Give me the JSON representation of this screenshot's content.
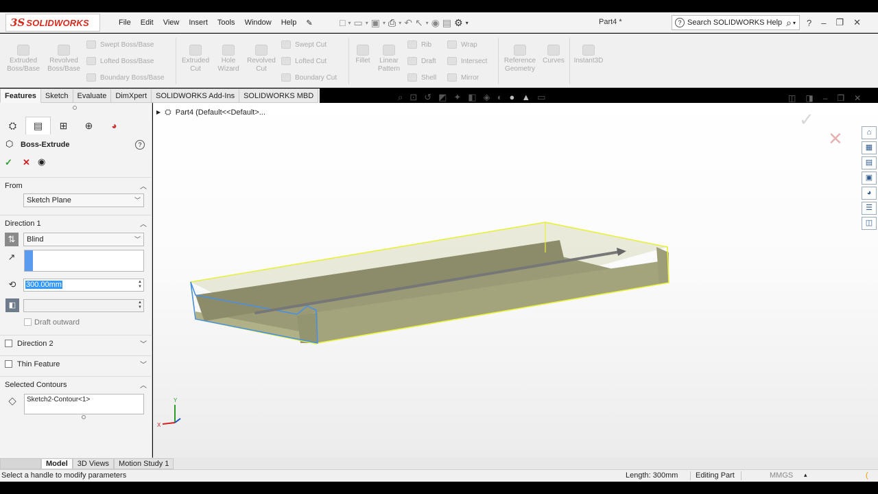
{
  "app": {
    "logo_ds": "3S",
    "logo_text": "SOLIDWORKS",
    "doc_title": "Part4 *"
  },
  "menu": [
    "File",
    "Edit",
    "View",
    "Insert",
    "Tools",
    "Window",
    "Help"
  ],
  "help_search": {
    "label": "Search SOLIDWORKS Help"
  },
  "toolbar": {
    "extruded_boss": "Extruded Boss/Base",
    "revolved_boss": "Revolved Boss/Base",
    "swept_boss": "Swept Boss/Base",
    "lofted_boss": "Lofted Boss/Base",
    "boundary_boss": "Boundary Boss/Base",
    "extruded_cut": "Extruded Cut",
    "hole_wizard": "Hole Wizard",
    "revolved_cut": "Revolved Cut",
    "swept_cut": "Swept Cut",
    "lofted_cut": "Lofted Cut",
    "boundary_cut": "Boundary Cut",
    "fillet": "Fillet",
    "linear_pattern": "Linear Pattern",
    "rib": "Rib",
    "draft": "Draft",
    "shell": "Shell",
    "wrap": "Wrap",
    "intersect": "Intersect",
    "mirror": "Mirror",
    "reference_geometry": "Reference Geometry",
    "curves": "Curves",
    "instant3d": "Instant3D"
  },
  "tabs": [
    "Features",
    "Sketch",
    "Evaluate",
    "DimXpert",
    "SOLIDWORKS Add-Ins",
    "SOLIDWORKS MBD"
  ],
  "feature": {
    "title": "Boss-Extrude",
    "from_label": "From",
    "from_value": "Sketch Plane",
    "direction1_label": "Direction 1",
    "end_condition": "Blind",
    "depth": "300.00mm",
    "draft_outward": "Draft outward",
    "direction2_label": "Direction 2",
    "thin_feature_label": "Thin Feature",
    "selected_contours_label": "Selected Contours",
    "contour": "Sketch2-Contour<1>"
  },
  "tree": {
    "root": "Part4  (Default<<Default>..."
  },
  "bottom_tabs": [
    "Model",
    "3D Views",
    "Motion Study 1"
  ],
  "status": {
    "message": "Select a handle to modify parameters",
    "length": "Length: 300mm",
    "mode": "Editing Part",
    "units": "MMGS"
  },
  "colors": {
    "accent_red": "#d52b1e",
    "preview_yellow": "#e8f03a",
    "edge_blue": "#4a90e2",
    "body": "#a6a77e"
  }
}
